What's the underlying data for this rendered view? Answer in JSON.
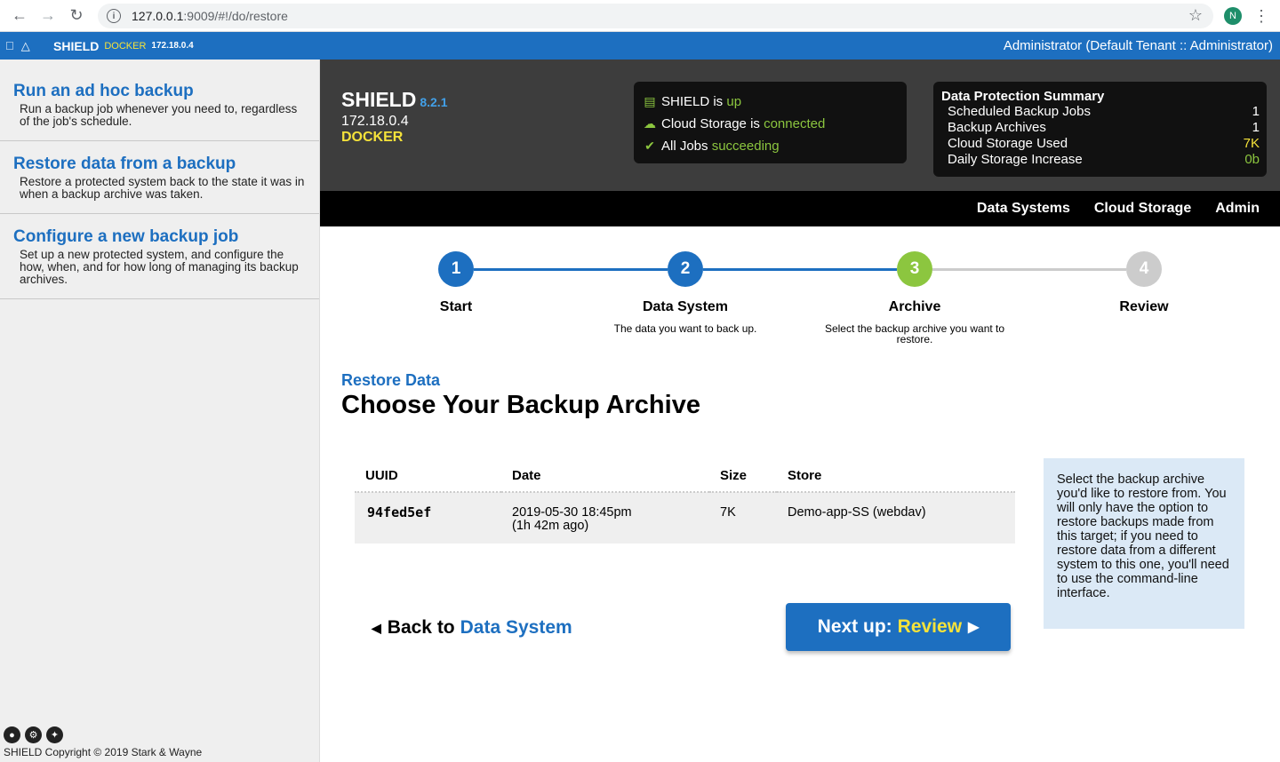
{
  "browser": {
    "url_host": "127.0.0.1",
    "url_path": ":9009/#!/do/restore",
    "profile_initial": "N",
    "icons": [
      "back-arrow-icon",
      "forward-arrow-icon",
      "reload-icon",
      "info-icon",
      "star-icon",
      "kebab-menu-icon"
    ]
  },
  "topbar": {
    "brand": "SHIELD",
    "env": "DOCKER",
    "ip": "172.18.0.4",
    "user": "Administrator (Default Tenant :: Administrator)",
    "icons": [
      "apple-icon",
      "linux-icon"
    ]
  },
  "sidebar": {
    "items": [
      {
        "title": "Run an ad hoc backup",
        "desc": "Run a backup job whenever you need to, regardless of the job's schedule."
      },
      {
        "title": "Restore data from a backup",
        "desc": "Restore a protected system back to the state it was in when a backup archive was taken."
      },
      {
        "title": "Configure a new backup job",
        "desc": "Set up a new protected system, and configure the how, when, and for how long of managing its backup archives."
      }
    ],
    "footer": "SHIELD Copyright © 2019 Stark & Wayne",
    "social_icons": [
      "github-icon",
      "settings-icon",
      "twitter-icon"
    ]
  },
  "header": {
    "name": "SHIELD",
    "version": "8.2.1",
    "ip": "172.18.0.4",
    "env": "DOCKER",
    "status": [
      {
        "prefix": "SHIELD is ",
        "value": "up",
        "icon": "server-check-icon"
      },
      {
        "prefix": "Cloud Storage is ",
        "value": "connected",
        "icon": "cloud-icon"
      },
      {
        "prefix": "All Jobs ",
        "value": "succeeding",
        "icon": "check-badge-icon"
      }
    ],
    "summary": {
      "title": "Data Protection Summary",
      "rows": [
        {
          "label": "Scheduled Backup Jobs",
          "value": "1"
        },
        {
          "label": "Backup Archives",
          "value": "1"
        },
        {
          "label": "Cloud Storage Used",
          "value": "7K"
        },
        {
          "label": "Daily Storage Increase",
          "value": "0b"
        }
      ]
    }
  },
  "nav": [
    "Data Systems",
    "Cloud Storage",
    "Admin"
  ],
  "colors": {
    "brand_blue": "#1d6fc0",
    "green": "#8cc63f",
    "yellow": "#f5e23a",
    "step_inactive": "#cccccc"
  },
  "steps": [
    {
      "num": "1",
      "label": "Start",
      "sub": ""
    },
    {
      "num": "2",
      "label": "Data System",
      "sub": "The data you want to back up."
    },
    {
      "num": "3",
      "label": "Archive",
      "sub": "Select the backup archive you want to restore."
    },
    {
      "num": "4",
      "label": "Review",
      "sub": ""
    }
  ],
  "content": {
    "crumb": "Restore Data",
    "title": "Choose Your Backup Archive",
    "table": {
      "headers": [
        "UUID",
        "Date",
        "Size",
        "Store"
      ],
      "rows": [
        {
          "uuid": "94fed5ef",
          "date": "2019-05-30 18:45pm",
          "ago": "(1h 42m ago)",
          "size": "7K",
          "store": "Demo-app-SS (webdav)"
        }
      ]
    },
    "help": "Select the backup archive you'd like to restore from. You will only have the option to restore backups made from this target; if you need to restore data from a different system to this one, you'll need to use the command-line interface.",
    "back_prefix": "Back to",
    "back_target": "Data System",
    "next_prefix": "Next up:",
    "next_target": "Review"
  }
}
